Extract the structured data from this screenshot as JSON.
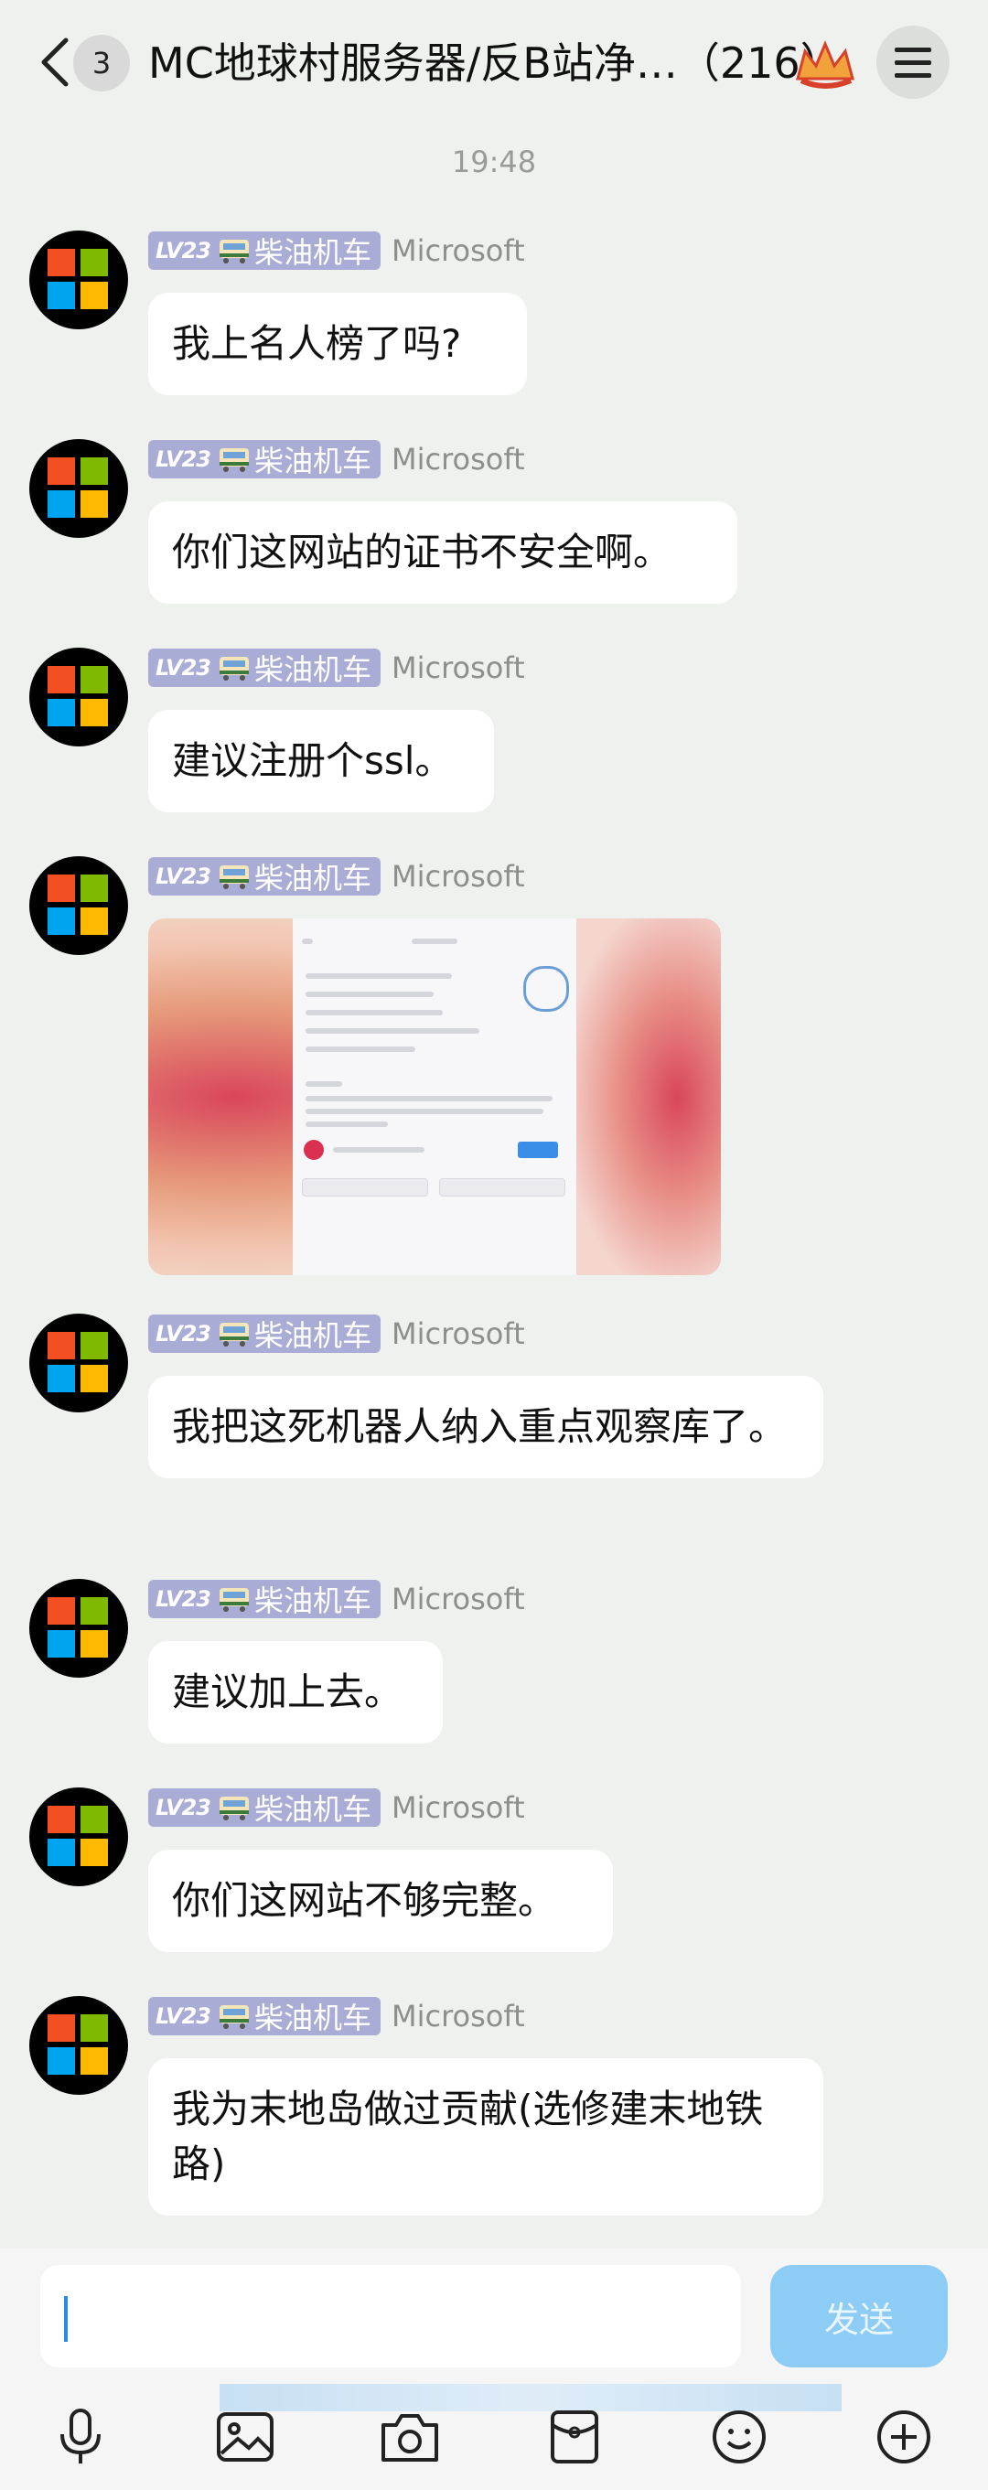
{
  "header": {
    "unread_count": "3",
    "title": "MC地球村服务器/反B站净…（216）"
  },
  "timestamp": "19:48",
  "badge": {
    "level": "LV23",
    "title": "柴油机车"
  },
  "sender": "Microsoft",
  "messages": [
    {
      "text": "我上名人榜了吗?"
    },
    {
      "text": "你们这网站的证书不安全啊。"
    },
    {
      "text": "建议注册个ssl。"
    },
    {
      "text": ""
    },
    {
      "text": "我把这死机器人纳入重点观察库了。"
    },
    {
      "text": "建议加上去。"
    },
    {
      "text": "你们这网站不够完整。"
    },
    {
      "text": "我为末地岛做过贡献(选修建末地铁路)"
    }
  ],
  "input": {
    "value": "",
    "send_label": "发送"
  },
  "toolbar_icons": [
    "microphone-icon",
    "image-icon",
    "camera-icon",
    "red-packet-icon",
    "emoji-icon",
    "plus-icon"
  ],
  "colors": {
    "background": "#eef1ee",
    "badge": "#a9acd4",
    "send": "#8dcdf5"
  }
}
